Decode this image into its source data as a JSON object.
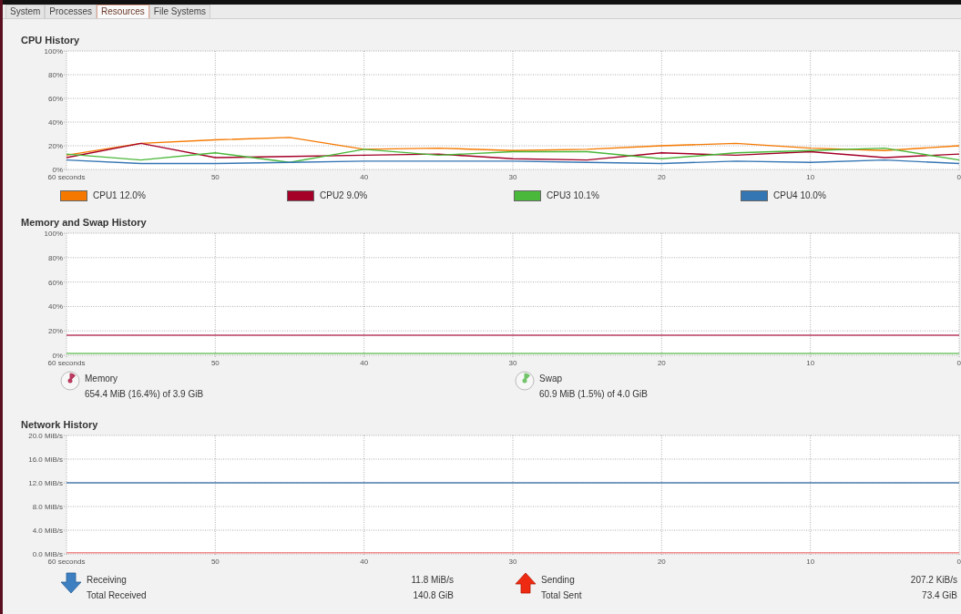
{
  "tabs": [
    {
      "label": "System",
      "selected": false
    },
    {
      "label": "Processes",
      "selected": false
    },
    {
      "label": "Resources",
      "selected": true
    },
    {
      "label": "File Systems",
      "selected": false
    }
  ],
  "cpu_history": {
    "title": "CPU History",
    "readings": [
      "12.0%",
      "9.0%",
      "10.1%",
      "10.0%"
    ],
    "chart_data": {
      "type": "line",
      "grid": true,
      "x": [
        60,
        55,
        50,
        45,
        40,
        35,
        30,
        25,
        20,
        15,
        10,
        5,
        0
      ],
      "xlim": [
        60,
        0
      ],
      "ylim": [
        0,
        100
      ],
      "xticks": [
        {
          "value": 60,
          "label": "60 seconds"
        },
        {
          "value": 50,
          "label": "50"
        },
        {
          "value": 40,
          "label": "40"
        },
        {
          "value": 30,
          "label": "30"
        },
        {
          "value": 20,
          "label": "20"
        },
        {
          "value": 10,
          "label": "10"
        },
        {
          "value": 0,
          "label": "0"
        }
      ],
      "yticks": [
        {
          "value": 100,
          "label": "100%"
        },
        {
          "value": 80,
          "label": "80%"
        },
        {
          "value": 60,
          "label": "60%"
        },
        {
          "value": 40,
          "label": "40%"
        },
        {
          "value": 20,
          "label": "20%"
        },
        {
          "value": 0,
          "label": "0%"
        }
      ],
      "series": [
        {
          "name": "CPU1",
          "color": "#f57900",
          "values": [
            12,
            22,
            25,
            27,
            17,
            18,
            16,
            17,
            20,
            22,
            18,
            16,
            20
          ]
        },
        {
          "name": "CPU2",
          "color": "#a40028",
          "values": [
            10,
            22,
            10,
            11,
            12,
            13,
            9,
            8,
            14,
            12,
            15,
            10,
            13
          ]
        },
        {
          "name": "CPU3",
          "color": "#4ab83a",
          "values": [
            13,
            8,
            14,
            6,
            17,
            12,
            15,
            15,
            9,
            14,
            16,
            18,
            8
          ]
        },
        {
          "name": "CPU4",
          "color": "#3475b3",
          "values": [
            8,
            5,
            5,
            6,
            7,
            7,
            7,
            6,
            5,
            7,
            6,
            8,
            5
          ]
        }
      ]
    }
  },
  "memory_history": {
    "title": "Memory and Swap History",
    "legend": [
      {
        "kind": "pie",
        "detail": "654.4 MiB (16.4%) of 3.9 GiB"
      },
      {
        "kind": "pie",
        "detail": "60.9 MiB (1.5%) of 4.0 GiB"
      }
    ],
    "chart_data": {
      "type": "line",
      "grid": true,
      "x": [
        60,
        0
      ],
      "xlim": [
        60,
        0
      ],
      "ylim": [
        0,
        100
      ],
      "xticks": [
        {
          "value": 60,
          "label": "60 seconds"
        },
        {
          "value": 50,
          "label": "50"
        },
        {
          "value": 40,
          "label": "40"
        },
        {
          "value": 30,
          "label": "30"
        },
        {
          "value": 20,
          "label": "20"
        },
        {
          "value": 10,
          "label": "10"
        },
        {
          "value": 0,
          "label": "0"
        }
      ],
      "yticks": [
        {
          "value": 100,
          "label": "100%"
        },
        {
          "value": 80,
          "label": "80%"
        },
        {
          "value": 60,
          "label": "60%"
        },
        {
          "value": 40,
          "label": "40%"
        },
        {
          "value": 20,
          "label": "20%"
        },
        {
          "value": 0,
          "label": "0%"
        }
      ],
      "series": [
        {
          "name": "Memory",
          "color": "#b83a5e",
          "values": [
            16.4,
            16.4
          ]
        },
        {
          "name": "Swap",
          "color": "#73c46a",
          "values": [
            1.5,
            1.5
          ]
        }
      ]
    }
  },
  "network_history": {
    "title": "Network History",
    "legend": [
      {
        "kind": "down",
        "rate": "11.8 MiB/s",
        "total_label": "Total Received",
        "total": "140.8 GiB"
      },
      {
        "kind": "up",
        "rate": "207.2 KiB/s",
        "total_label": "Total Sent",
        "total": "73.4 GiB"
      }
    ],
    "chart_data": {
      "type": "line",
      "grid": true,
      "x": [
        60,
        0
      ],
      "xlim": [
        60,
        0
      ],
      "ylim": [
        0,
        20
      ],
      "xticks": [
        {
          "value": 60,
          "label": "60 seconds"
        },
        {
          "value": 50,
          "label": "50"
        },
        {
          "value": 40,
          "label": "40"
        },
        {
          "value": 30,
          "label": "30"
        },
        {
          "value": 20,
          "label": "20"
        },
        {
          "value": 10,
          "label": "10"
        },
        {
          "value": 0,
          "label": "0"
        }
      ],
      "yticks": [
        {
          "value": 20,
          "label": "20.0 MiB/s"
        },
        {
          "value": 16,
          "label": "16.0 MiB/s"
        },
        {
          "value": 12,
          "label": "12.0 MiB/s"
        },
        {
          "value": 8,
          "label": "8.0 MiB/s"
        },
        {
          "value": 4,
          "label": "4.0 MiB/s"
        },
        {
          "value": 0,
          "label": "0.0 MiB/s"
        }
      ],
      "series": [
        {
          "name": "Receiving",
          "color": "#4f7fae",
          "values": [
            12,
            12
          ]
        },
        {
          "name": "Sending",
          "color": "#f08a8a",
          "values": [
            0.2,
            0.2
          ]
        }
      ]
    }
  }
}
